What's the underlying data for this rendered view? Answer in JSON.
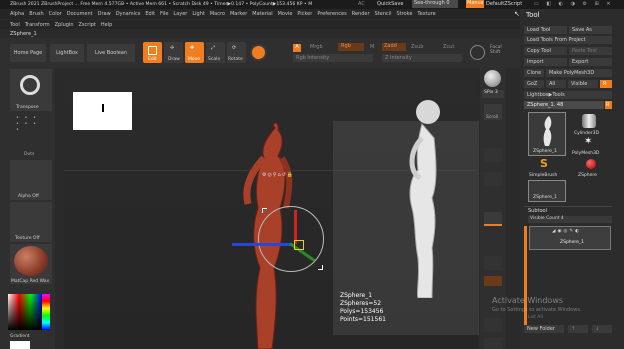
{
  "titlebar": {
    "text": "ZBrush 2021   ZBrushProject  ... Free Mem 4.577GB • Active Mem 661 • Scratch Disk 49 • Timer▶0.147 • PolyCount▶153.456 KP • M",
    "ac": "AC",
    "quicksave": "QuickSave",
    "seethrough": "See-through  0",
    "menus": "Menus",
    "defaultzscript": "DefaultZScript"
  },
  "menu1": [
    "Alpha",
    "Brush",
    "Color",
    "Document",
    "Draw",
    "Dynamics",
    "Edit",
    "File",
    "Layer",
    "Light",
    "Macro",
    "Marker",
    "Material",
    "Movie",
    "Picker",
    "Preferences",
    "Render",
    "Stencil",
    "Stroke",
    "Texture"
  ],
  "menu2": [
    "Tool",
    "Transform",
    "Zplugin",
    "Zscript",
    "Help"
  ],
  "subtool_name": "ZSphere_1",
  "toolbar": {
    "home": "Home Page",
    "lightbox": "LightBox",
    "liveboolean": "Live Boolean",
    "edit": "Edit",
    "draw": "Draw",
    "move": "Move",
    "scale": "Scale",
    "rotate": "Rotate",
    "a_label": "A",
    "mrgb": "Mrgb",
    "rgb": "Rgb",
    "m": "M",
    "zadd": "Zadd",
    "zsub": "Zsub",
    "zcut": "Zcut",
    "rgb_intensity": "Rgb Intensity",
    "z_intensity": "Z Intensity",
    "focal": "Focal Shift"
  },
  "left": {
    "transpose": "Transpose",
    "dots": "Dots",
    "alpha": "Alpha Off",
    "texture": "Texture Off",
    "matcap": "MatCap Red Wax",
    "gradient": "Gradient"
  },
  "right_icons": {
    "spix": "SPix 3",
    "scroll": "Scroll"
  },
  "info": {
    "name": "ZSphere_1",
    "zspheres": "ZSpheres=52",
    "polys": "Polys=153456",
    "points": "Points=151561"
  },
  "watermark": {
    "line1": "Activate Windows",
    "line2": "Go to Settings to activate Windows."
  },
  "tool_panel": {
    "title": "Tool",
    "load_tool": "Load Tool",
    "save_as": "Save As",
    "load_from_project": "Load Tools From Project",
    "copy_tool": "Copy Tool",
    "paste_tool": "Paste Tool",
    "import": "Import",
    "export": "Export",
    "clone": "Clone",
    "make_polymesh": "Make PolyMesh3D",
    "goz": "GoZ",
    "all": "All",
    "visible": "Visible",
    "r": "R",
    "lightbox_tools": "Lightbox▶Tools",
    "zsphere_count": "ZSphere_1. 48",
    "thumbs": [
      "ZSphere_1",
      "Cylinder3D",
      "PolyMesh3D",
      "SimpleBrush",
      "ZSphere",
      "ZSphere_1"
    ],
    "subtool": "Subtool",
    "visible_count": "Visible Count 4",
    "subtool_item": "ZSphere_1",
    "list_all": "List All",
    "new_folder": "New Folder"
  }
}
